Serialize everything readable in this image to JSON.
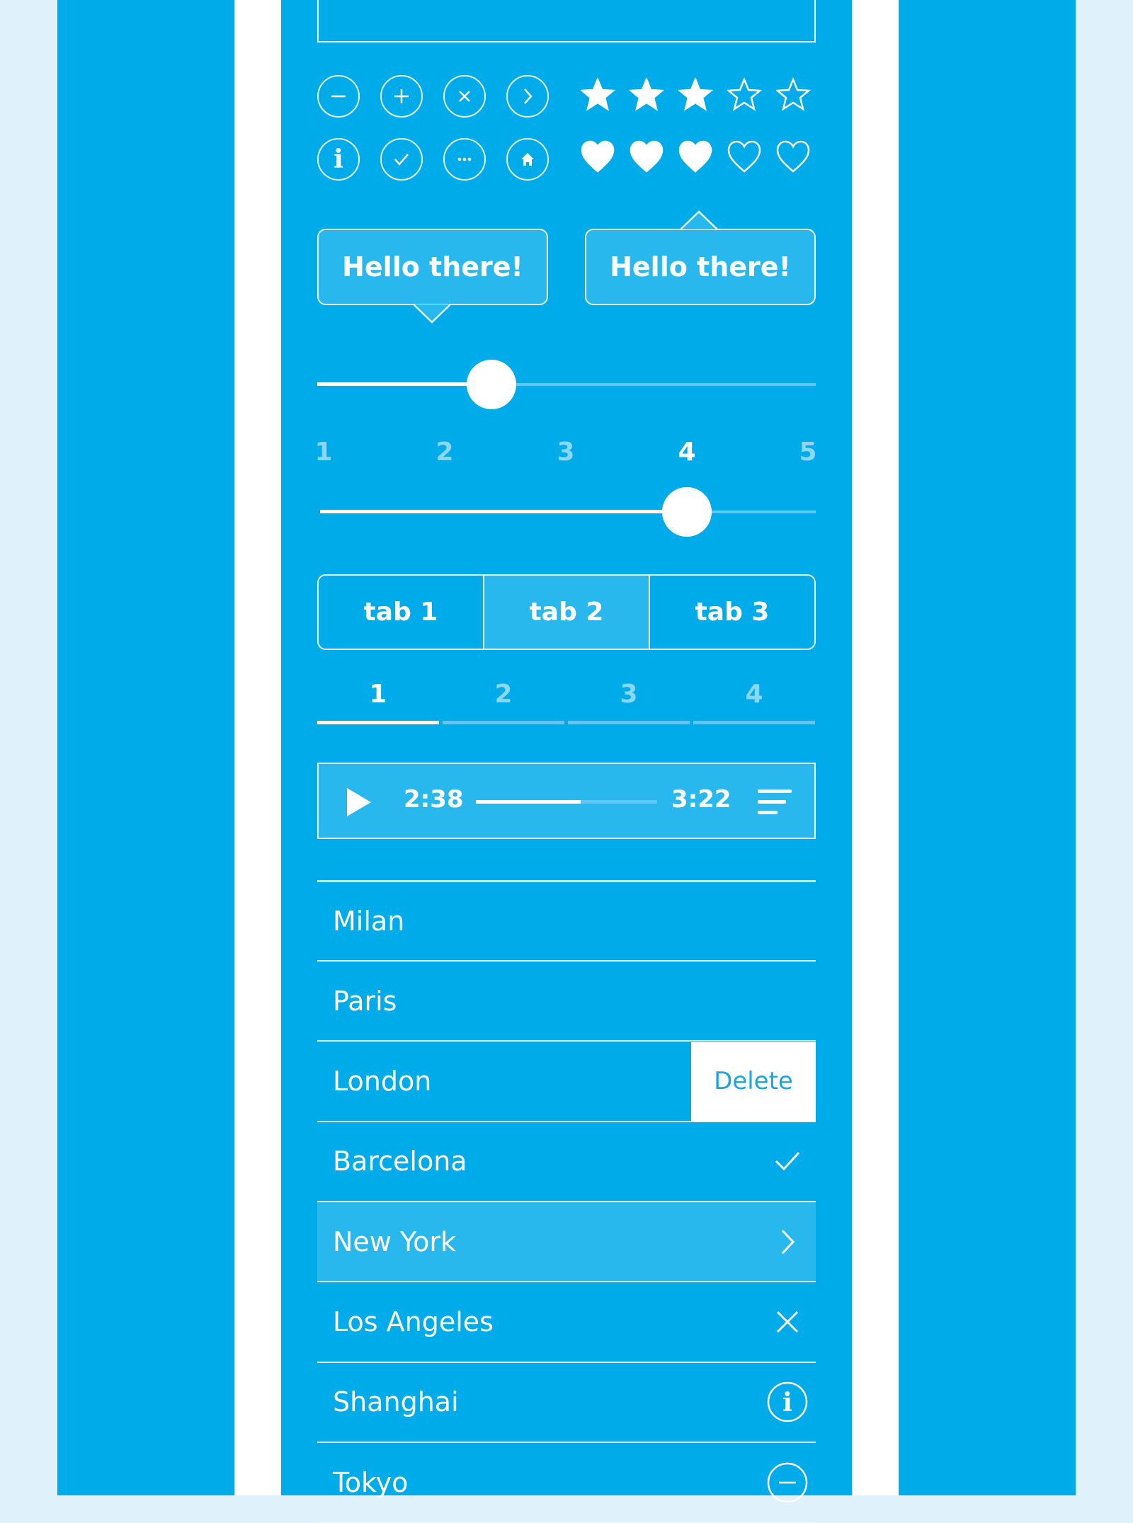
{
  "colors": {
    "background": "#dff2fb",
    "panel": "#00abe9",
    "highlight": "#28b8ee",
    "delete_text": "#1aa6de"
  },
  "icon_buttons": [
    "minus-circle-icon",
    "plus-circle-icon",
    "close-circle-icon",
    "chevron-right-circle-icon",
    "info-circle-icon",
    "check-circle-icon",
    "more-circle-icon",
    "home-circle-icon"
  ],
  "star_rating": {
    "value": 3,
    "max": 5
  },
  "heart_rating": {
    "value": 3,
    "max": 5
  },
  "tooltips": [
    {
      "text": "Hello there!",
      "arrow": "bottom"
    },
    {
      "text": "Hello there!",
      "arrow": "top"
    }
  ],
  "slider1": {
    "value_percent": 35
  },
  "slider2": {
    "labels": [
      "1",
      "2",
      "3",
      "4",
      "5"
    ],
    "value": 4
  },
  "tabs": [
    {
      "label": "tab 1"
    },
    {
      "label": "tab 2",
      "active": true
    },
    {
      "label": "tab 3"
    }
  ],
  "steps": {
    "labels": [
      "1",
      "2",
      "3",
      "4"
    ],
    "active": 1
  },
  "player": {
    "elapsed": "2:38",
    "total": "3:22",
    "progress_percent": 58
  },
  "list": [
    {
      "label": "Milan"
    },
    {
      "label": "Paris"
    },
    {
      "label": "London",
      "action": "Delete"
    },
    {
      "label": "Barcelona",
      "icon": "check-icon"
    },
    {
      "label": "New York",
      "icon": "chevron-right-icon",
      "highlighted": true
    },
    {
      "label": "Los Angeles",
      "icon": "close-icon"
    },
    {
      "label": "Shanghai",
      "icon": "info-circle-icon"
    },
    {
      "label": "Tokyo",
      "icon": "minus-circle-icon"
    }
  ]
}
